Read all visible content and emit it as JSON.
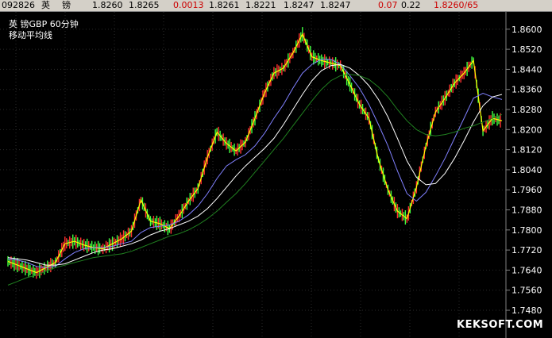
{
  "header": {
    "code": "092826",
    "name_1": "英",
    "name_2": "镑",
    "open": "1.8260",
    "high": "1.8265",
    "change": "0.0013",
    "v1": "1.8261",
    "v2": "1.8221",
    "v3": "1.8247",
    "v4": "1.8247",
    "pct": "0.07",
    "amp": "0.22",
    "bidask": "1.8260/65"
  },
  "chart_title": "英    镑GBP    60分钟",
  "chart_subtitle": "移动平均线",
  "watermark": "KEKSOFT.COM",
  "colors": {
    "background": "#000000",
    "grid": "#2a2a2a",
    "axis_text": "#ffffff",
    "candle_up": "#ff3030",
    "candle_down": "#40ff40",
    "ma_fast": "#ffff00",
    "ma_mid": "#8080ff",
    "ma_slow": "#ffffff",
    "ma_long": "#208020",
    "header_red": "#cc0000"
  },
  "chart_data": {
    "type": "line",
    "ylim": [
      1.742,
      1.865
    ],
    "yticks": [
      "1.8600",
      "1.8520",
      "1.8440",
      "1.8360",
      "1.8280",
      "1.8200",
      "1.8120",
      "1.8040",
      "1.7960",
      "1.7880",
      "1.7800",
      "1.7720",
      "1.7640",
      "1.7560",
      "1.7480"
    ],
    "ytick_values": [
      1.86,
      1.852,
      1.844,
      1.836,
      1.828,
      1.82,
      1.812,
      1.804,
      1.796,
      1.788,
      1.78,
      1.772,
      1.764,
      1.756,
      1.748
    ],
    "x": [
      0,
      6,
      12,
      18,
      24,
      30,
      36,
      42,
      48,
      54,
      60,
      66,
      72,
      78,
      84,
      90,
      96,
      102,
      108,
      114,
      120,
      126,
      132,
      138,
      144,
      150,
      156,
      162,
      168,
      174,
      180,
      186,
      192,
      198,
      204,
      210,
      216,
      222,
      228,
      234,
      240,
      246,
      252,
      258,
      264,
      270,
      276,
      282,
      288,
      294,
      300,
      306,
      312
    ],
    "series": [
      {
        "values": [
          1.7675,
          1.766,
          1.7645,
          1.763,
          1.765,
          1.767,
          1.7745,
          1.7755,
          1.774,
          1.773,
          1.7725,
          1.7745,
          1.7765,
          1.7795,
          1.792,
          1.7835,
          1.7825,
          1.7805,
          1.7855,
          1.7915,
          1.7965,
          1.809,
          1.819,
          1.8145,
          1.8115,
          1.815,
          1.8245,
          1.8345,
          1.8425,
          1.8445,
          1.8505,
          1.858,
          1.849,
          1.8475,
          1.8465,
          1.8455,
          1.838,
          1.83,
          1.8245,
          1.808,
          1.796,
          1.7875,
          1.7845,
          1.797,
          1.8135,
          1.827,
          1.8325,
          1.8385,
          1.8425,
          1.8475,
          1.8195,
          1.8245,
          1.8235
        ]
      },
      {
        "values": [
          1.7685,
          1.768,
          1.767,
          1.7655,
          1.765,
          1.7655,
          1.7685,
          1.771,
          1.7725,
          1.773,
          1.773,
          1.7735,
          1.7745,
          1.7755,
          1.779,
          1.781,
          1.7815,
          1.782,
          1.7835,
          1.786,
          1.7895,
          1.7945,
          1.8005,
          1.8055,
          1.808,
          1.81,
          1.8135,
          1.8185,
          1.8245,
          1.83,
          1.8365,
          1.8425,
          1.846,
          1.848,
          1.848,
          1.846,
          1.8415,
          1.8365,
          1.83,
          1.822,
          1.8135,
          1.8035,
          1.7945,
          1.7915,
          1.795,
          1.8015,
          1.8085,
          1.8165,
          1.8245,
          1.8325,
          1.8345,
          1.833,
          1.832
        ]
      },
      {
        "values": [
          1.769,
          1.7685,
          1.768,
          1.767,
          1.766,
          1.766,
          1.7665,
          1.768,
          1.7695,
          1.771,
          1.772,
          1.7725,
          1.7735,
          1.7745,
          1.776,
          1.778,
          1.7795,
          1.7805,
          1.782,
          1.7835,
          1.7855,
          1.7885,
          1.7925,
          1.797,
          1.8015,
          1.8055,
          1.809,
          1.8125,
          1.8165,
          1.822,
          1.828,
          1.834,
          1.8395,
          1.8435,
          1.8455,
          1.846,
          1.8445,
          1.8415,
          1.8375,
          1.832,
          1.825,
          1.8165,
          1.8075,
          1.801,
          1.798,
          1.7985,
          1.8025,
          1.8085,
          1.8155,
          1.823,
          1.8295,
          1.833,
          1.834
        ]
      },
      {
        "values": [
          1.758,
          1.7595,
          1.761,
          1.762,
          1.7635,
          1.765,
          1.766,
          1.767,
          1.768,
          1.769,
          1.7695,
          1.77,
          1.7705,
          1.7715,
          1.773,
          1.7745,
          1.776,
          1.7775,
          1.7785,
          1.78,
          1.782,
          1.7845,
          1.7875,
          1.791,
          1.7945,
          1.7985,
          1.803,
          1.8075,
          1.812,
          1.8165,
          1.8215,
          1.8265,
          1.8315,
          1.836,
          1.8395,
          1.8415,
          1.842,
          1.8415,
          1.84,
          1.837,
          1.833,
          1.828,
          1.8235,
          1.82,
          1.818,
          1.8175,
          1.818,
          1.819,
          1.8205,
          1.8215,
          1.823,
          1.8245,
          1.826
        ]
      }
    ]
  }
}
